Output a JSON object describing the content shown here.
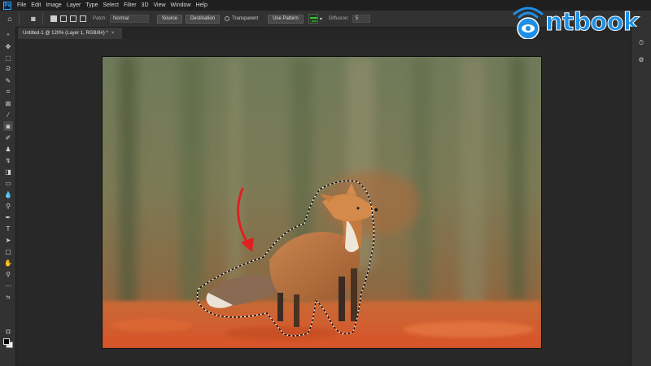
{
  "menubar": {
    "app_icon": "Ps",
    "items": [
      "File",
      "Edit",
      "Image",
      "Layer",
      "Type",
      "Select",
      "Filter",
      "3D",
      "View",
      "Window",
      "Help"
    ]
  },
  "options_bar": {
    "patch_label": "Patch:",
    "patch_mode": "Normal",
    "source_label": "Source",
    "destination_label": "Destination",
    "transparent_label": "Transparent",
    "use_pattern_label": "Use Pattern",
    "diffusion_label": "Diffusion:",
    "diffusion_value": "5"
  },
  "document": {
    "tab_title": "Untitled-1 @ 120% (Layer 1, RGB/8#) *",
    "close_glyph": "×"
  },
  "brand": {
    "text": "ntbook",
    "color": "#1e8fe6"
  },
  "colors": {
    "accent": "#31a8ff",
    "selection_arrow": "#e02020"
  }
}
